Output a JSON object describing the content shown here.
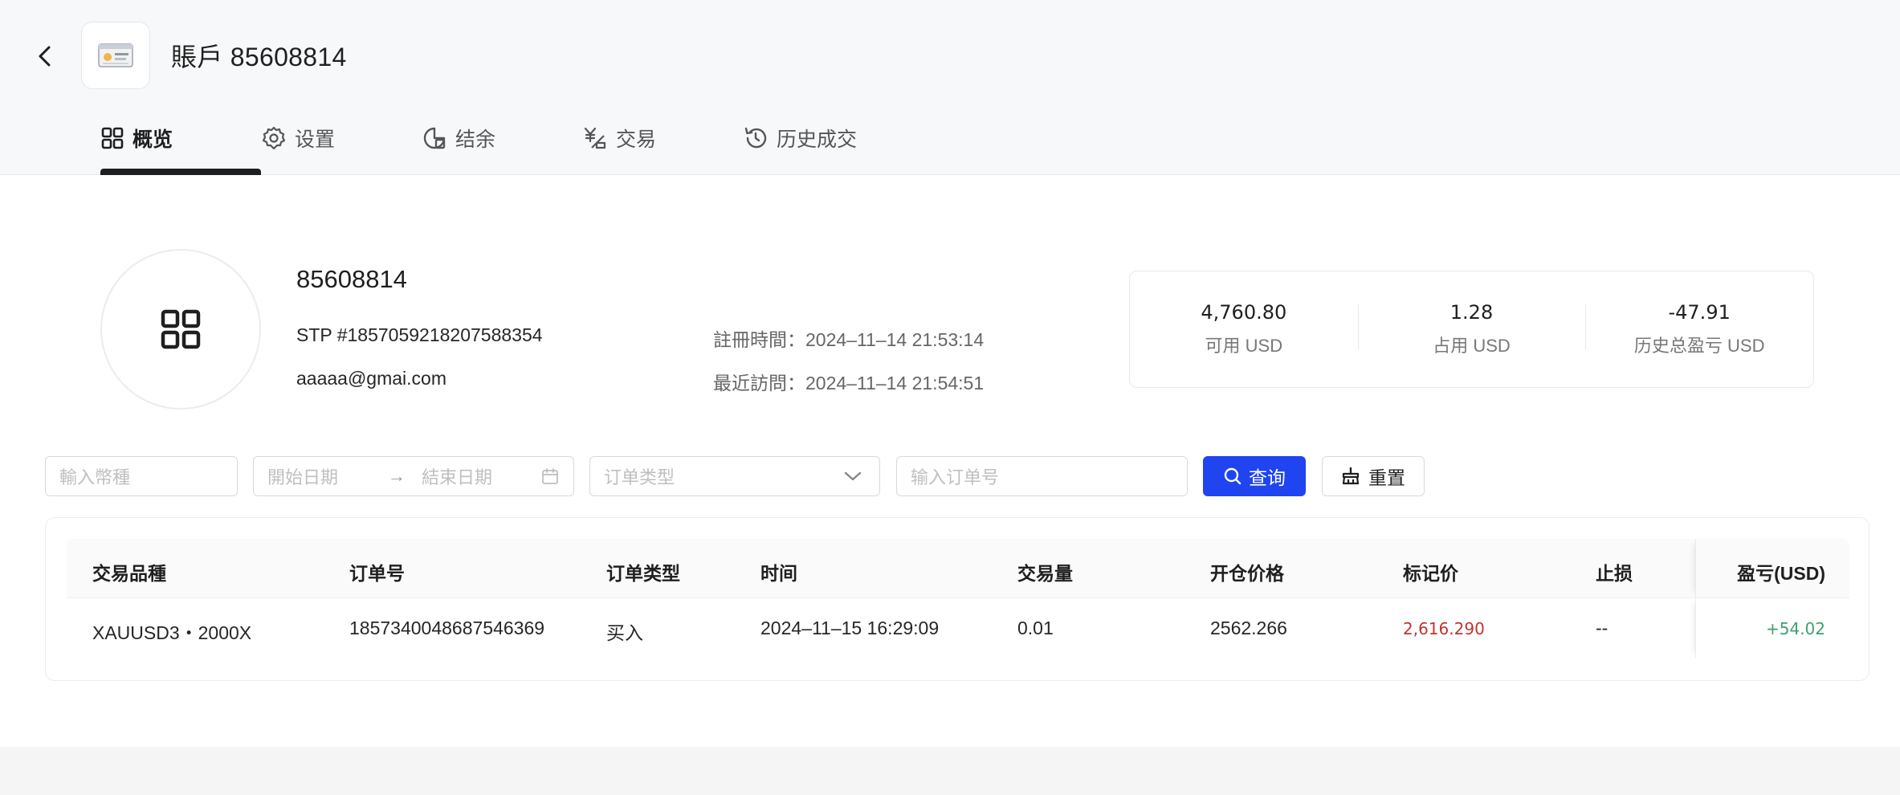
{
  "header": {
    "title": "賬戶 85608814"
  },
  "tabs": [
    {
      "label": "概览",
      "icon": "grid-icon"
    },
    {
      "label": "设置",
      "icon": "gear-icon"
    },
    {
      "label": "结余",
      "icon": "balance-icon"
    },
    {
      "label": "交易",
      "icon": "trade-icon"
    },
    {
      "label": "历史成交",
      "icon": "history-icon"
    }
  ],
  "profile": {
    "account_number": "85608814",
    "stp": "STP #1857059218207588354",
    "email": "aaaaa@gmai.com",
    "registered": "註冊時間：2024–11–14 21:53:14",
    "last_visit": "最近訪問：2024–11–14 21:54:51"
  },
  "stats": [
    {
      "value": "4,760.80",
      "label": "可用 USD"
    },
    {
      "value": "1.28",
      "label": "占用 USD"
    },
    {
      "value": "-47.91",
      "label": "历史总盈亏 USD"
    }
  ],
  "filters": {
    "currency_placeholder": "輸入幣種",
    "start_date_placeholder": "開始日期",
    "date_arrow": "→",
    "end_date_placeholder": "結束日期",
    "order_type_placeholder": "订单类型",
    "order_no_placeholder": "输入订单号",
    "query_label": "查询",
    "reset_label": "重置"
  },
  "table": {
    "columns": [
      "交易品種",
      "订单号",
      "订单类型",
      "时间",
      "交易量",
      "开仓价格",
      "标记价",
      "止损",
      "盈亏(USD)"
    ],
    "rows": [
      [
        "XAUUSD3・2000X",
        "1857340048687546369",
        "买入",
        "2024–11–15 16:29:09",
        "0.01",
        "2562.266",
        "2,616.290",
        "--",
        "+54.02"
      ]
    ]
  },
  "colors": {
    "primary": "#1f44f0",
    "loss": "#c0342f",
    "profit": "#3f9f6f"
  }
}
